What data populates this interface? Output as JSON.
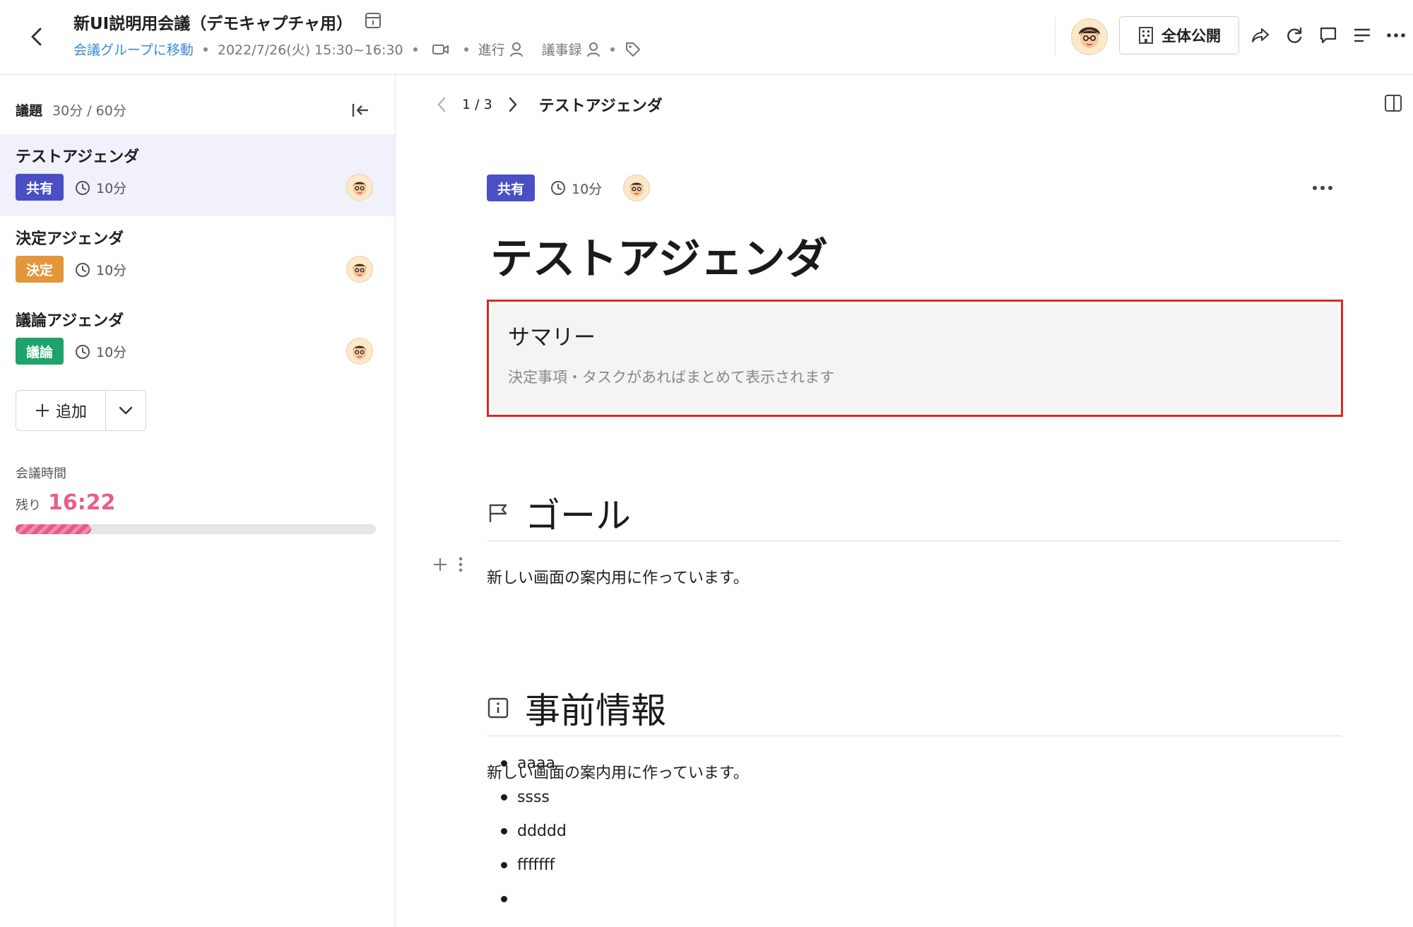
{
  "header": {
    "title": "新UI説明用会議（デモキャプチャ用）",
    "group_link": "会議グループに移動",
    "datetime": "2022/7/26(火) 15:30~16:30",
    "facilitator_label": "進行",
    "minutes_label": "議事録",
    "visibility_label": "全体公開"
  },
  "sidebar": {
    "heading": "議題",
    "time_summary": "30分 / 60分",
    "items": [
      {
        "name": "テストアジェンダ",
        "badge": "共有",
        "badge_color": "#4a4fc4",
        "duration": "10分"
      },
      {
        "name": "決定アジェンダ",
        "badge": "決定",
        "badge_color": "#e3973b",
        "duration": "10分"
      },
      {
        "name": "議論アジェンダ",
        "badge": "議論",
        "badge_color": "#1ea36b",
        "duration": "10分"
      }
    ],
    "add_label": "追加",
    "meeting_time_label": "会議時間",
    "remaining_label": "残り",
    "remaining_time": "16:22",
    "progress_fraction": 0.21
  },
  "main": {
    "pager": "1 / 3",
    "current_title": "テストアジェンダ",
    "badge": "共有",
    "badge_color": "#4a4fc4",
    "duration": "10分",
    "agenda_title": "テストアジェンダ",
    "summary_title": "サマリー",
    "summary_desc": "決定事項・タスクがあればまとめて表示されます",
    "goal_heading": "ゴール",
    "goal_text": "新しい画面の案内用に作っています。",
    "prior_heading": "事前情報",
    "prior_text": "新しい画面の案内用に作っています。",
    "bullets": [
      "aaaa",
      "ssss",
      "ddddd",
      "fffffff",
      ""
    ]
  },
  "colors": {
    "accent_link": "#3a8ad6",
    "timer": "#e75f86",
    "summary_border": "#e0281f",
    "active_row": "#f0f1fa"
  }
}
